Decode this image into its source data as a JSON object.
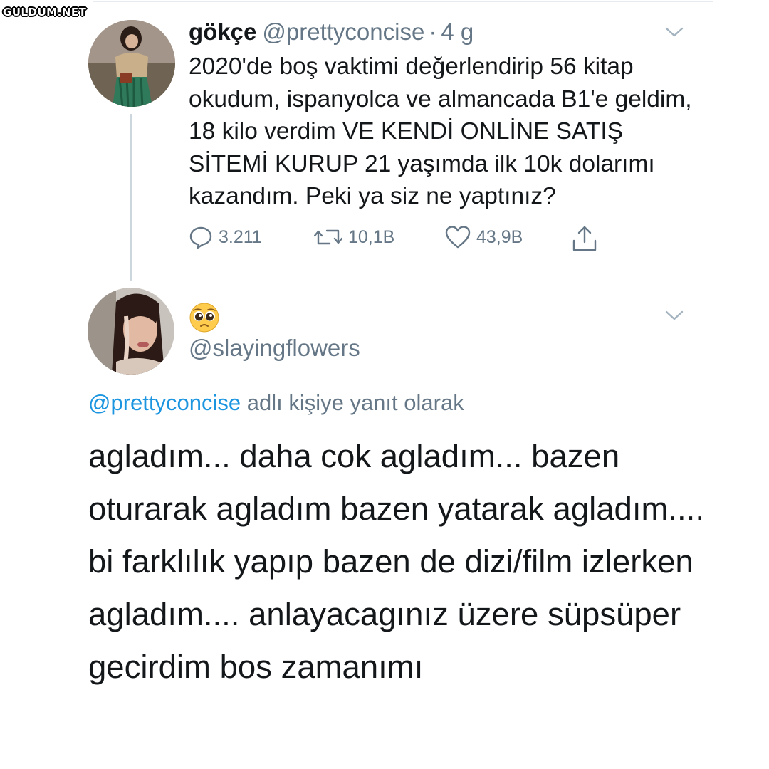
{
  "watermark": {
    "text": "GULDUM.NET"
  },
  "tweet1": {
    "display_name": "gökçe",
    "handle": "@prettyconcise",
    "separator": "·",
    "time": "4 g",
    "text": "2020'de boş vaktimi değerlendirip 56 kitap okudum, ispanyolca ve almancada B1'e geldim, 18 kilo verdim VE KENDİ ONLİNE SATIŞ SİTEMİ KURUP 21 yaşımda ilk 10k dolarımı kazandım. Peki ya siz ne yaptınız?",
    "actions": {
      "reply_count": "3.211",
      "retweet_count": "10,1B",
      "like_count": "43,9B",
      "reply_icon": "reply-bubble-icon",
      "retweet_icon": "retweet-icon",
      "like_icon": "heart-icon",
      "share_icon": "share-icon"
    },
    "menu_icon": "chevron-down-icon"
  },
  "tweet2": {
    "display_name_icon": "pleading-face-emoji",
    "handle": "@slayingflowers",
    "reply_context": {
      "mention": "@prettyconcise",
      "suffix": " adlı kişiye yanıt olarak"
    },
    "text": "agladım... daha cok agladım... bazen oturarak agladım bazen yatarak agladım.... bi farklılık yapıp bazen de dizi/film izlerken agladım.... anlayacagınız üzere süpsüper gecirdim bos zamanımı",
    "menu_icon": "chevron-down-icon"
  },
  "colors": {
    "text_primary": "#14171a",
    "text_secondary": "#657786",
    "link": "#1b95e0",
    "thread_line": "#ccd6dd"
  }
}
